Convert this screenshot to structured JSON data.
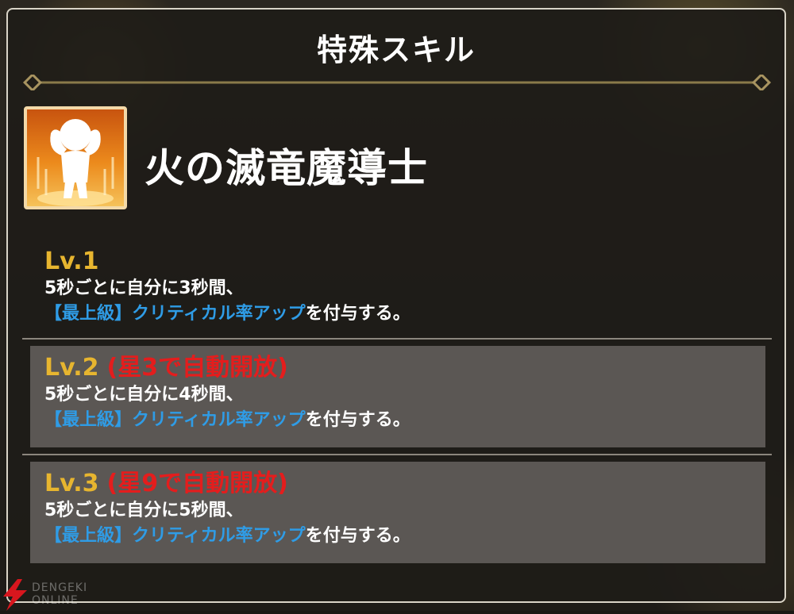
{
  "dialog": {
    "title": "特殊スキル"
  },
  "skill": {
    "icon": "flexing-character-icon",
    "name": "火の滅竜魔導士"
  },
  "levels": [
    {
      "label": "Lv.1",
      "lock_note": "",
      "line1": "5秒ごとに自分に3秒間、",
      "line2_highlight": "【最上級】クリティカル率アップ",
      "line2_rest": "を付与する。"
    },
    {
      "label": "Lv.2",
      "lock_note": "(星3で自動開放)",
      "line1": "5秒ごとに自分に4秒間、",
      "line2_highlight": "【最上級】クリティカル率アップ",
      "line2_rest": "を付与する。"
    },
    {
      "label": "Lv.3",
      "lock_note": "(星9で自動開放)",
      "line1": "5秒ごとに自分に5秒間、",
      "line2_highlight": "【最上級】クリティカル率アップ",
      "line2_rest": "を付与する。"
    }
  ],
  "watermark": {
    "line1": "DENGEKI",
    "line2": "ONLINE"
  },
  "colors": {
    "level_label": "#e7b52f",
    "lock_note": "#e41d1d",
    "highlight": "#2f9ce6",
    "locked_row_bg": "#5b5754"
  }
}
